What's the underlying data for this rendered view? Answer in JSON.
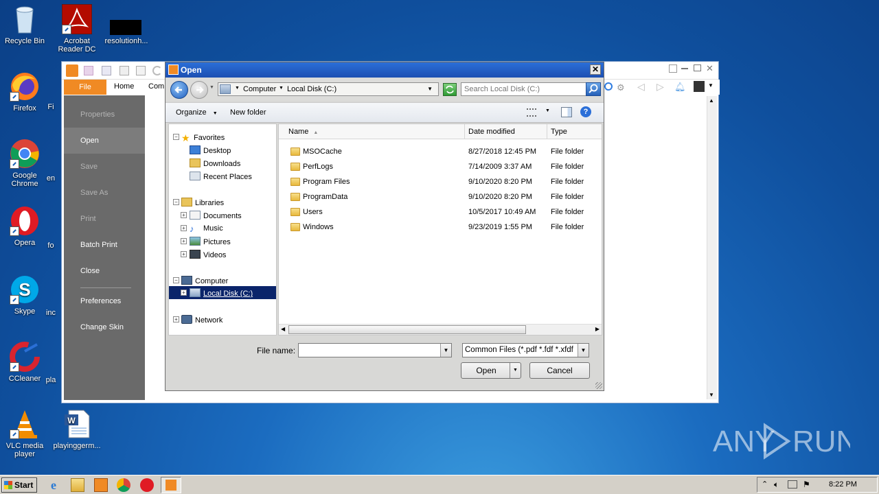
{
  "desktop": {
    "icons": [
      {
        "label": "Recycle Bin"
      },
      {
        "label": "Acrobat Reader DC"
      },
      {
        "label": "resolutionh..."
      },
      {
        "label": "Firefox"
      },
      {
        "label": "Fi"
      },
      {
        "label": "Google Chrome"
      },
      {
        "label": "en"
      },
      {
        "label": "Opera"
      },
      {
        "label": "fo"
      },
      {
        "label": "Skype"
      },
      {
        "label": "inc"
      },
      {
        "label": "CCleaner"
      },
      {
        "label": "pla"
      },
      {
        "label": "VLC media player"
      },
      {
        "label": "playinggerm..."
      }
    ],
    "watermark": "ANY RUN"
  },
  "foxit": {
    "tabs": [
      "File",
      "Home",
      "Com"
    ],
    "backstage": [
      {
        "label": "Properties",
        "state": "dim"
      },
      {
        "label": "Open",
        "state": "selected"
      },
      {
        "label": "Save",
        "state": "dim"
      },
      {
        "label": "Save As",
        "state": "dim"
      },
      {
        "label": "Print",
        "state": "dim"
      },
      {
        "label": "Batch Print",
        "state": "normal"
      },
      {
        "label": "Close",
        "state": "normal"
      },
      {
        "label": "Preferences",
        "state": "normal"
      },
      {
        "label": "Change Skin",
        "state": "normal"
      }
    ]
  },
  "dialog": {
    "title": "Open",
    "address": {
      "crumb1": "Computer",
      "crumb2": "Local Disk (C:)"
    },
    "search_placeholder": "Search Local Disk (C:)",
    "toolbar": {
      "organize": "Organize",
      "new_folder": "New folder"
    },
    "nav": {
      "favorites": "Favorites",
      "desktop": "Desktop",
      "downloads": "Downloads",
      "recent": "Recent Places",
      "libraries": "Libraries",
      "documents": "Documents",
      "music": "Music",
      "pictures": "Pictures",
      "videos": "Videos",
      "computer": "Computer",
      "local_disk": "Local Disk (C:)",
      "network": "Network"
    },
    "columns": {
      "name": "Name",
      "date": "Date modified",
      "type": "Type"
    },
    "files": [
      {
        "name": "MSOCache",
        "date": "8/27/2018 12:45 PM",
        "type": "File folder"
      },
      {
        "name": "PerfLogs",
        "date": "7/14/2009 3:37 AM",
        "type": "File folder"
      },
      {
        "name": "Program Files",
        "date": "9/10/2020 8:20 PM",
        "type": "File folder"
      },
      {
        "name": "ProgramData",
        "date": "9/10/2020 8:20 PM",
        "type": "File folder"
      },
      {
        "name": "Users",
        "date": "10/5/2017 10:49 AM",
        "type": "File folder"
      },
      {
        "name": "Windows",
        "date": "9/23/2019 1:55 PM",
        "type": "File folder"
      }
    ],
    "file_name_label": "File name:",
    "file_name_value": "",
    "file_type": "Common Files (*.pdf *.fdf *.xfdf",
    "open_button": "Open",
    "cancel_button": "Cancel"
  },
  "taskbar": {
    "start_label": "Start",
    "clock": "8:22 PM"
  },
  "colors": {
    "accent": "#f08a24",
    "selection": "#0a246a",
    "dialog_title": "#1c4fb2"
  }
}
